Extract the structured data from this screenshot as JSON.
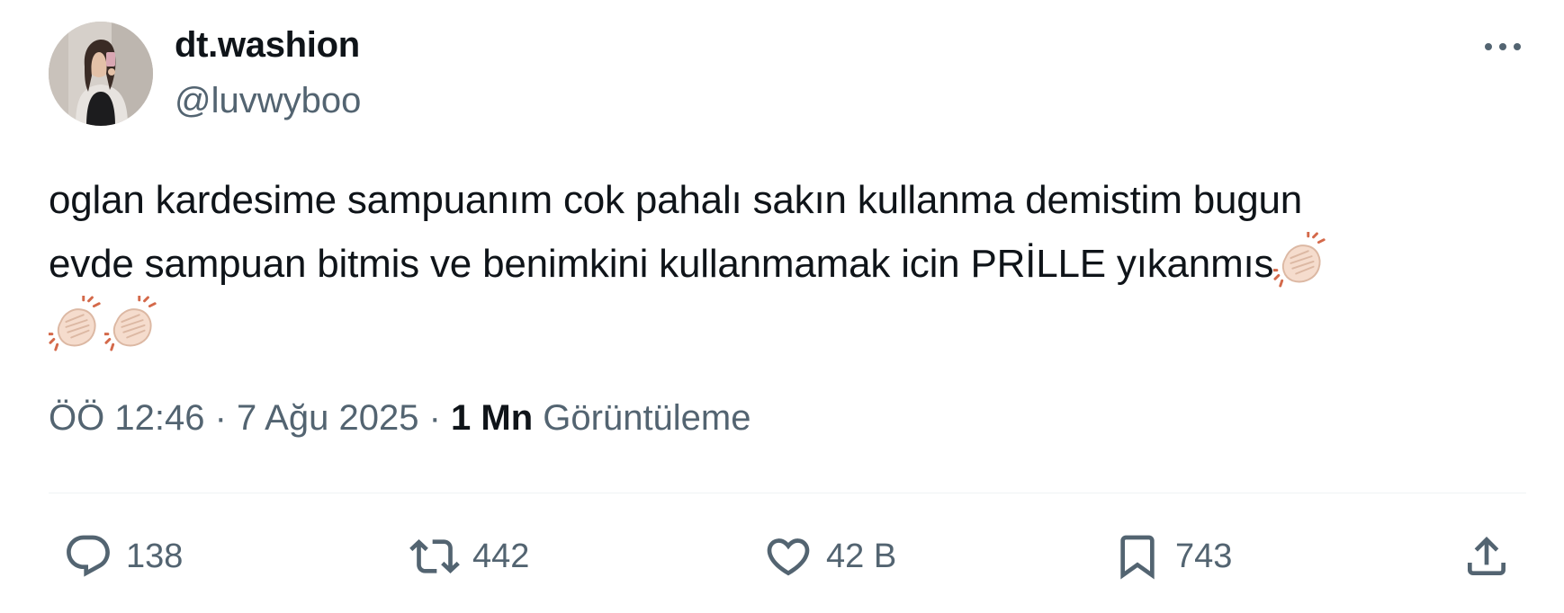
{
  "author": {
    "display_name": "dt.washion",
    "handle": "@luvwyboo"
  },
  "tweet": {
    "line1": "oglan kardesime sampuanım cok pahalı sakın kullanma demistim bugun",
    "line2": "evde sampuan bitmis ve benimkini kullanmamak icin PRİLLE yıkanmıs",
    "emoji": "clapping-hands"
  },
  "meta": {
    "time": "ÖÖ 12:46",
    "separator": "·",
    "date": "7 Ağu 2025",
    "views_count": "1 Mn",
    "views_label": "Görüntüleme"
  },
  "actions": {
    "replies": "138",
    "reposts": "442",
    "likes": "42 B",
    "bookmarks": "743"
  },
  "icons": {
    "more": "more-horizontal-icon",
    "reply": "reply-icon",
    "repost": "repost-icon",
    "like": "heart-icon",
    "bookmark": "bookmark-icon",
    "share": "share-icon"
  },
  "colors": {
    "text": "#0f1419",
    "secondary": "#536471",
    "divider": "#eff3f4"
  }
}
